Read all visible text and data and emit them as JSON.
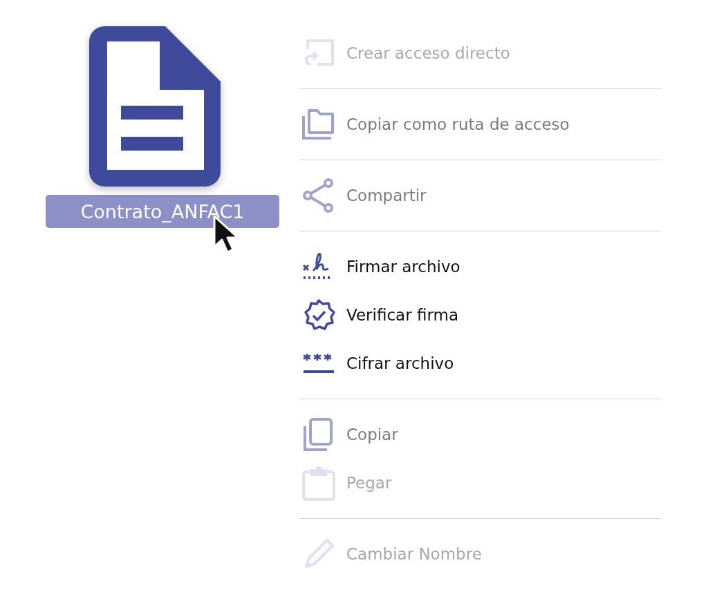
{
  "file": {
    "name": "Contrato_ANFAC1",
    "selected": true
  },
  "menu": {
    "groups": [
      {
        "items": [
          {
            "kind": "shortcut",
            "label": "Crear acceso directo",
            "disabled": true,
            "highlighted": false
          }
        ]
      },
      {
        "items": [
          {
            "kind": "folder",
            "label": "Copiar como ruta de acceso",
            "disabled": false,
            "highlighted": false
          }
        ]
      },
      {
        "items": [
          {
            "kind": "share",
            "label": "Compartir",
            "disabled": false,
            "highlighted": false
          }
        ]
      },
      {
        "items": [
          {
            "kind": "sign",
            "label": "Firmar archivo",
            "disabled": false,
            "highlighted": true
          },
          {
            "kind": "verify",
            "label": "Verificar firma",
            "disabled": false,
            "highlighted": true
          },
          {
            "kind": "encrypt",
            "label": "Cifrar archivo",
            "disabled": false,
            "highlighted": true
          }
        ]
      },
      {
        "items": [
          {
            "kind": "copy",
            "label": "Copiar",
            "disabled": false,
            "highlighted": false
          },
          {
            "kind": "paste",
            "label": "Pegar",
            "disabled": true,
            "highlighted": false
          }
        ]
      },
      {
        "items": [
          {
            "kind": "rename",
            "label": "Cambiar Nombre",
            "disabled": true,
            "highlighted": false
          }
        ]
      }
    ]
  }
}
